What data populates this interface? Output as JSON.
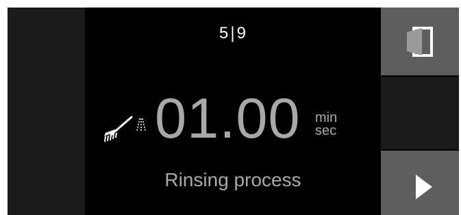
{
  "program": {
    "current_step": "5",
    "separator": "|",
    "total_steps": "9"
  },
  "timer": {
    "value": "01.00",
    "unit_top": "min",
    "unit_bottom": "sec"
  },
  "status": {
    "text": "Rinsing process"
  },
  "icons": {
    "phase_icon": "rinse-brush-spray-icon",
    "door_button_icon": "door-open-icon",
    "start_button_icon": "play-triangle-icon"
  },
  "colors": {
    "background": "#000000",
    "side_panel": "#1b1b1b",
    "button": "#5e5e5e",
    "primary_text": "#ffffff",
    "secondary_text": "#a8a8a8"
  }
}
